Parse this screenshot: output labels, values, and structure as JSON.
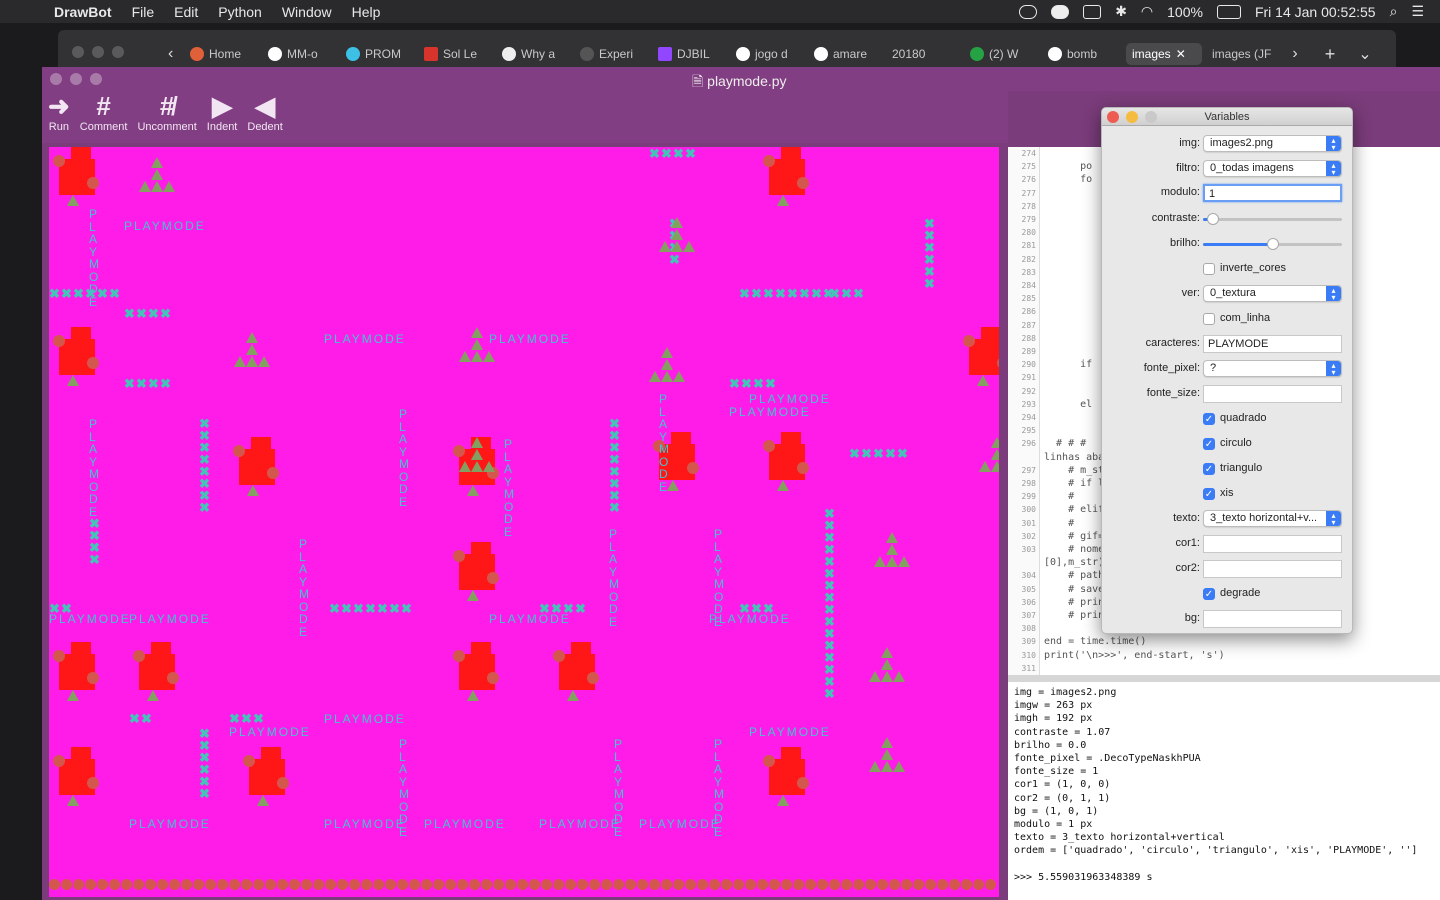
{
  "menubar": {
    "app": "DrawBot",
    "items": [
      "File",
      "Edit",
      "Python",
      "Window",
      "Help"
    ],
    "battery": "100%",
    "datetime": "Fri 14 Jan  00:52:55"
  },
  "browser": {
    "tabs": [
      {
        "label": "Home",
        "color": "#e0603a"
      },
      {
        "label": "MM-o",
        "color": "#ffffff"
      },
      {
        "label": "PROM",
        "color": "#3cc0e6"
      },
      {
        "label": "Sol Le",
        "color": "#d9342b"
      },
      {
        "label": "Why a",
        "color": "#eeeeee"
      },
      {
        "label": "Experi",
        "color": "#555555"
      },
      {
        "label": "DJBIL",
        "color": "#9146ff"
      },
      {
        "label": "jogo d",
        "color": "#ffffff"
      },
      {
        "label": "amare",
        "color": "#ffffff"
      },
      {
        "label": "20180",
        "color": "#323234"
      },
      {
        "label": "(2) W",
        "color": "#25a244"
      },
      {
        "label": "bomb",
        "color": "#ffffff"
      },
      {
        "label": "images",
        "color": "#4a4a4c"
      },
      {
        "label": "images (JF",
        "color": "#323234"
      }
    ]
  },
  "window": {
    "title": "playmode.py"
  },
  "toolbar": {
    "run": "Run",
    "comment": "Comment",
    "uncomment": "Uncomment",
    "indent": "Indent",
    "dedent": "Dedent"
  },
  "canvas": {
    "background": "#ff1ce8",
    "text": "PLAYMODE"
  },
  "code": {
    "lines": [
      {
        "n": "274",
        "t": ""
      },
      {
        "n": "275",
        "t": "      po"
      },
      {
        "n": "276",
        "t": "      fo"
      },
      {
        "n": "277",
        "t": ""
      },
      {
        "n": "278",
        "t": ""
      },
      {
        "n": "279",
        "t": ""
      },
      {
        "n": "280",
        "t": ""
      },
      {
        "n": "281",
        "t": ""
      },
      {
        "n": "282",
        "t": ""
      },
      {
        "n": "283",
        "t": ""
      },
      {
        "n": "284",
        "t": "                                            )"
      },
      {
        "n": "285",
        "t": ""
      },
      {
        "n": "286",
        "t": ""
      },
      {
        "n": "287",
        "t": ""
      },
      {
        "n": "288",
        "t": ""
      },
      {
        "n": "289",
        "t": ""
      },
      {
        "n": "290",
        "t": "      if"
      },
      {
        "n": "291",
        "t": ""
      },
      {
        "n": "292",
        "t": ""
      },
      {
        "n": "293",
        "t": "      el"
      },
      {
        "n": "294",
        "t": ""
      },
      {
        "n": "295",
        "t": ""
      },
      {
        "n": "296",
        "t": "  # # #                                   ente as"
      },
      {
        "n": "",
        "t": "linhas aba"
      },
      {
        "n": "297",
        "t": "    # m_st"
      },
      {
        "n": "298",
        "t": "    # if l"
      },
      {
        "n": "299",
        "t": "    #"
      },
      {
        "n": "300",
        "t": "    # elif"
      },
      {
        "n": "301",
        "t": "    #"
      },
      {
        "n": "302",
        "t": "    # gif="
      },
      {
        "n": "303",
        "t": "    # nome                                t('.')"
      },
      {
        "n": "",
        "t": "[0],m_str)"
      },
      {
        "n": "304",
        "t": "    # path"
      },
      {
        "n": "305",
        "t": "    # save"
      },
      {
        "n": "306",
        "t": "    # prin"
      },
      {
        "n": "307",
        "t": "    # prin"
      },
      {
        "n": "308",
        "t": ""
      },
      {
        "n": "309",
        "t": "end = time.time()"
      },
      {
        "n": "310",
        "t": "print('\\n>>>', end-start, 's')"
      },
      {
        "n": "311",
        "t": ""
      }
    ]
  },
  "output": {
    "lines": [
      "img = images2.png",
      "imgw = 263 px",
      "imgh = 192 px",
      "contraste = 1.07",
      "brilho = 0.0",
      "fonte_pixel = .DecoTypeNaskhPUA",
      "fonte_size = 1",
      "cor1 = (1, 0, 0)",
      "cor2 = (0, 1, 1)",
      "bg = (1, 0, 1)",
      "modulo = 1 px",
      "texto = 3_texto horizontal+vertical",
      "ordem = ['quadrado', 'circulo', 'triangulo', 'xis', 'PLAYMODE', '']",
      "",
      ">>> 5.559031963348389 s"
    ]
  },
  "variables": {
    "title": "Variables",
    "img_label": "img:",
    "img": "images2.png",
    "filtro_label": "filtro:",
    "filtro": "0_todas imagens",
    "modulo_label": "modulo:",
    "modulo": "1",
    "contraste_label": "contraste:",
    "contraste_value": 0.07,
    "brilho_label": "brilho:",
    "brilho_value": 0.5,
    "inverte_label": "inverte_cores",
    "ver_label": "ver:",
    "ver": "0_textura",
    "com_linha_label": "com_linha",
    "caracteres_label": "caracteres:",
    "caracteres": "PLAYMODE",
    "fonte_pixel_label": "fonte_pixel:",
    "fonte_pixel": "?",
    "fonte_size_label": "fonte_size:",
    "fonte_size": "",
    "quadrado_label": "quadrado",
    "circulo_label": "circulo",
    "triangulo_label": "triangulo",
    "xis_label": "xis",
    "texto_label": "texto:",
    "texto": "3_texto horizontal+v...",
    "cor1_label": "cor1:",
    "cor1": "",
    "cor2_label": "cor2:",
    "cor2": "",
    "degrade_label": "degrade",
    "bg_label": "bg:",
    "bg": ""
  }
}
